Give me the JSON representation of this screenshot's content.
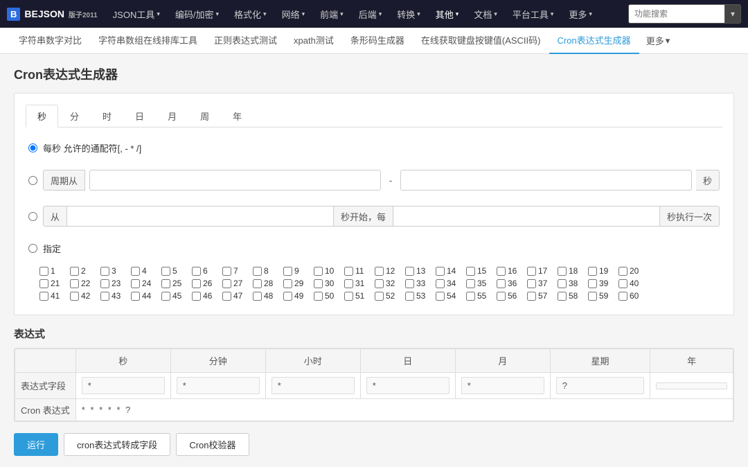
{
  "logo": {
    "box": "B",
    "name": "BEJSON",
    "sub": "版子2011"
  },
  "nav": {
    "items": [
      {
        "label": "JSON工具",
        "arrow": true
      },
      {
        "label": "编码/加密",
        "arrow": true
      },
      {
        "label": "格式化",
        "arrow": true
      },
      {
        "label": "网络",
        "arrow": true
      },
      {
        "label": "前端",
        "arrow": true
      },
      {
        "label": "后端",
        "arrow": true
      },
      {
        "label": "转换",
        "arrow": true
      },
      {
        "label": "其他",
        "arrow": true,
        "active": true
      },
      {
        "label": "文档",
        "arrow": true
      },
      {
        "label": "平台工具",
        "arrow": true
      },
      {
        "label": "更多",
        "arrow": true
      }
    ],
    "search_placeholder": "功能搜索"
  },
  "subnav": {
    "items": [
      {
        "label": "字符串数字对比"
      },
      {
        "label": "字符串数组在线排库工具"
      },
      {
        "label": "正则表达式测试"
      },
      {
        "label": "xpath测试"
      },
      {
        "label": "条形码生成器"
      },
      {
        "label": "在线获取键盘按键值(ASCII码)"
      },
      {
        "label": "Cron表达式生成器",
        "active": true
      }
    ],
    "more_label": "更多"
  },
  "page": {
    "title": "Cron表达式生成器"
  },
  "tabs": [
    "秒",
    "分",
    "时",
    "日",
    "月",
    "周",
    "年"
  ],
  "active_tab": 0,
  "options": {
    "every_second": {
      "label": "每秒 允许的通配符[, - * /]"
    },
    "period": {
      "label": "周期从",
      "dash": "-",
      "suffix": "秒"
    },
    "from": {
      "from_label": "从",
      "mid_label": "秒开始，每",
      "suffix_label": "秒执行一次"
    },
    "specify": {
      "label": "指定"
    }
  },
  "checkboxes": {
    "rows": [
      [
        1,
        2,
        3,
        4,
        5,
        6,
        7,
        8,
        9,
        10,
        11,
        12,
        13,
        14,
        15,
        16,
        17,
        18,
        19,
        20
      ],
      [
        21,
        22,
        23,
        24,
        25,
        26,
        27,
        28,
        29,
        30,
        31,
        32,
        33,
        34,
        35,
        36,
        37,
        38,
        39,
        40
      ],
      [
        41,
        42,
        43,
        44,
        45,
        46,
        47,
        48,
        49,
        50,
        51,
        52,
        53,
        54,
        55,
        56,
        57,
        58,
        59,
        60
      ]
    ]
  },
  "expression": {
    "section_title": "表达式",
    "columns": [
      "秒",
      "分钟",
      "小时",
      "日",
      "月",
      "星期",
      "年"
    ],
    "row1_label": "表达式字段",
    "row1_values": [
      "*",
      "*",
      "*",
      "*",
      "*",
      "?",
      ""
    ],
    "row2_label": "Cron 表达式",
    "row2_value": "* * * * * ?"
  },
  "buttons": {
    "run": "运行",
    "to_field": "cron表达式转成字段",
    "verify": "Cron校验器"
  }
}
